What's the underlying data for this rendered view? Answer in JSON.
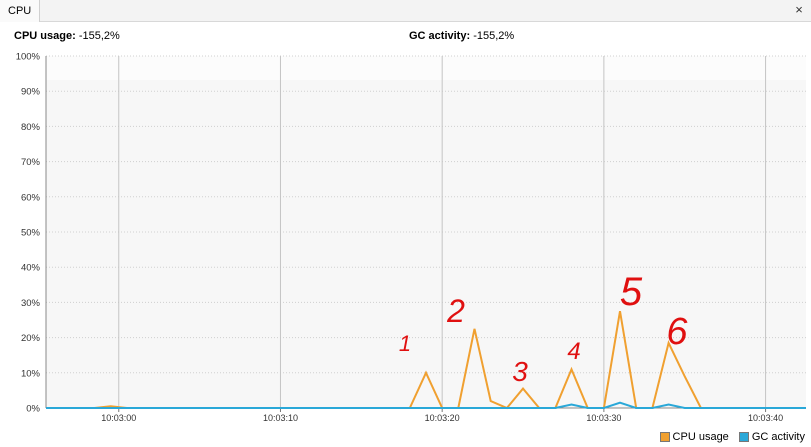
{
  "window": {
    "tab_title": "CPU",
    "close_glyph": "×"
  },
  "metrics": {
    "cpu_label": "CPU usage:",
    "cpu_value": "-155,2%",
    "gc_label": "GC activity:",
    "gc_value": "-155,2%"
  },
  "colors": {
    "cpu": "#f0a030",
    "gc": "#2aa8d8",
    "annotation": "#e01010"
  },
  "chart_data": {
    "type": "line",
    "ylim": [
      0,
      100
    ],
    "xlim": [
      "10:02:55.5",
      "10:03:42.5"
    ],
    "y_ticks": [
      "0%",
      "10%",
      "20%",
      "30%",
      "40%",
      "50%",
      "60%",
      "70%",
      "80%",
      "90%",
      "100%"
    ],
    "x_ticks": [
      "10:03:00",
      "10:03:10",
      "10:03:20",
      "10:03:30",
      "10:03:40"
    ],
    "grid": true,
    "legend_position": "bottom-right",
    "series": [
      {
        "name": "CPU usage",
        "x": [
          "10:02:55.5",
          "10:02:58.5",
          "10:02:59.5",
          "10:03:00.5",
          "10:03:18.0",
          "10:03:19.0",
          "10:03:20.0",
          "10:03:21.0",
          "10:03:22.0",
          "10:03:23.0",
          "10:03:24.0",
          "10:03:25.0",
          "10:03:26.0",
          "10:03:27.0",
          "10:03:28.0",
          "10:03:29.0",
          "10:03:30.0",
          "10:03:31.0",
          "10:03:32.0",
          "10:03:33.0",
          "10:03:34.0",
          "10:03:35.0",
          "10:03:36.0",
          "10:03:42.5"
        ],
        "values": [
          0,
          0,
          0.5,
          0,
          0,
          10,
          0,
          0,
          22.5,
          2,
          0,
          5.5,
          0,
          0,
          11,
          0,
          0,
          27.5,
          0,
          0,
          18.5,
          9,
          0,
          0
        ]
      },
      {
        "name": "GC activity",
        "x": [
          "10:02:55.5",
          "10:03:27.0",
          "10:03:28.0",
          "10:03:29.0",
          "10:03:30.0",
          "10:03:31.0",
          "10:03:32.0",
          "10:03:33.0",
          "10:03:34.0",
          "10:03:35.0",
          "10:03:42.5"
        ],
        "values": [
          0,
          0,
          1,
          0,
          0,
          1.5,
          0,
          0,
          1,
          0,
          0
        ]
      }
    ],
    "annotations": [
      "1",
      "2",
      "3",
      "4",
      "5",
      "6"
    ]
  },
  "legend": {
    "cpu_label": "CPU usage",
    "gc_label": "GC activity"
  }
}
